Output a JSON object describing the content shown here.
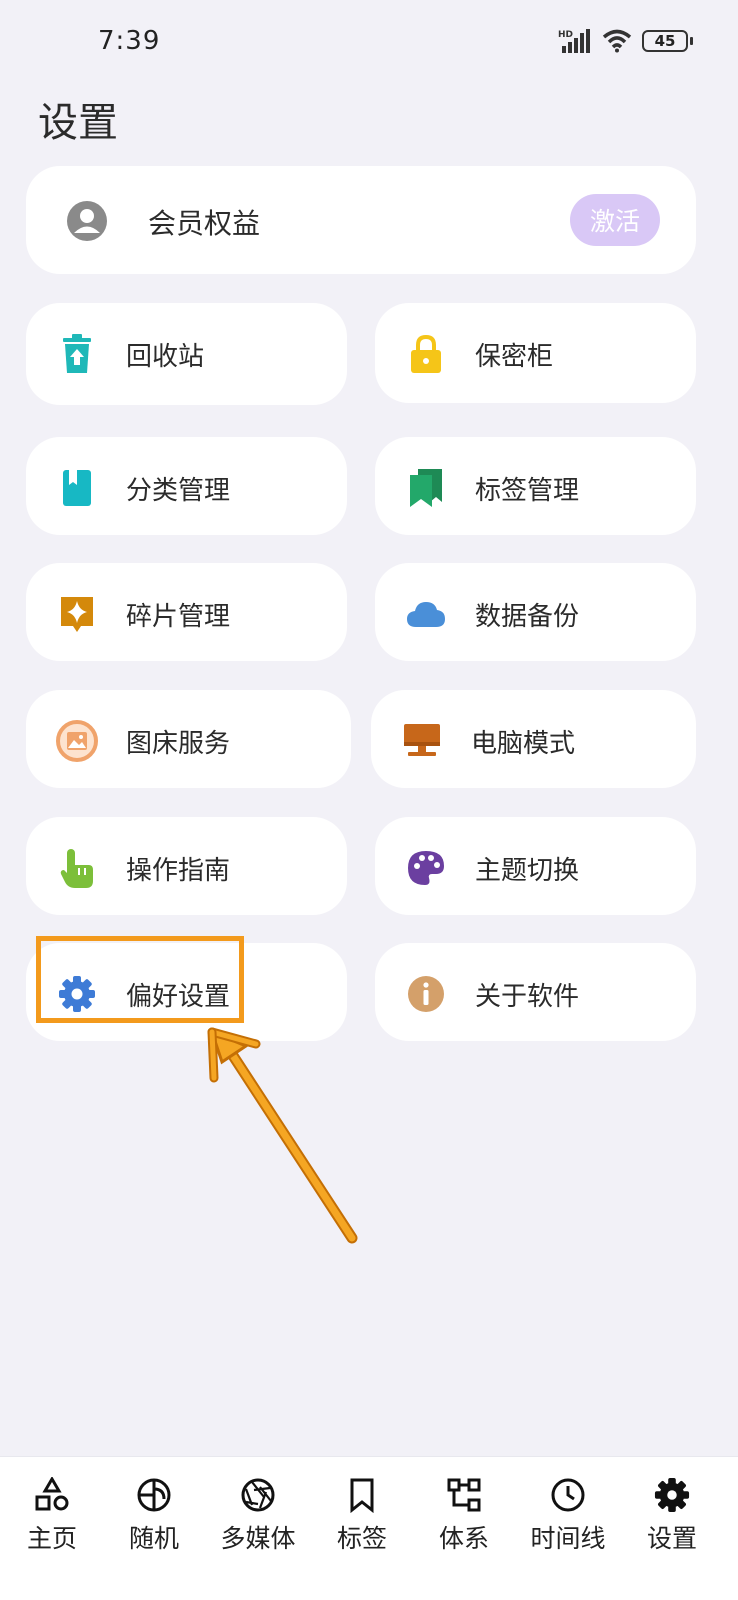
{
  "status_bar": {
    "time": "7:39",
    "network": "HD",
    "battery": "45"
  },
  "title": "设置",
  "member": {
    "label": "会员权益",
    "activate": "激活"
  },
  "items": [
    {
      "label": "回收站",
      "icon": "trash-icon",
      "color": "#1fb8b8"
    },
    {
      "label": "保密柜",
      "icon": "lock-icon",
      "color": "#f5c518"
    },
    {
      "label": "分类管理",
      "icon": "book-icon",
      "color": "#17b8c4"
    },
    {
      "label": "标签管理",
      "icon": "bookmarks-icon",
      "color": "#23a86a"
    },
    {
      "label": "碎片管理",
      "icon": "sparkle-icon",
      "color": "#d4890b"
    },
    {
      "label": "数据备份",
      "icon": "cloud-icon",
      "color": "#4a8fd8"
    },
    {
      "label": "图床服务",
      "icon": "image-icon",
      "color": "#f0a36b"
    },
    {
      "label": "电脑模式",
      "icon": "desktop-icon",
      "color": "#c7671a"
    },
    {
      "label": "操作指南",
      "icon": "hand-pointer-icon",
      "color": "#7cbf3a"
    },
    {
      "label": "主题切换",
      "icon": "palette-icon",
      "color": "#6b3fa0"
    },
    {
      "label": "偏好设置",
      "icon": "gear-icon",
      "color": "#3e7bd6"
    },
    {
      "label": "关于软件",
      "icon": "info-icon",
      "color": "#d4a06a"
    }
  ],
  "nav": [
    {
      "label": "主页",
      "icon": "home-shapes-icon"
    },
    {
      "label": "随机",
      "icon": "random-icon"
    },
    {
      "label": "多媒体",
      "icon": "aperture-icon"
    },
    {
      "label": "标签",
      "icon": "bookmark-icon"
    },
    {
      "label": "体系",
      "icon": "hierarchy-icon"
    },
    {
      "label": "时间线",
      "icon": "clock-icon"
    },
    {
      "label": "设置",
      "icon": "gear-icon"
    }
  ],
  "colors": {
    "background": "#f2f1f7",
    "highlight": "#f39a1c",
    "activate_bg": "#d9c8f6"
  }
}
